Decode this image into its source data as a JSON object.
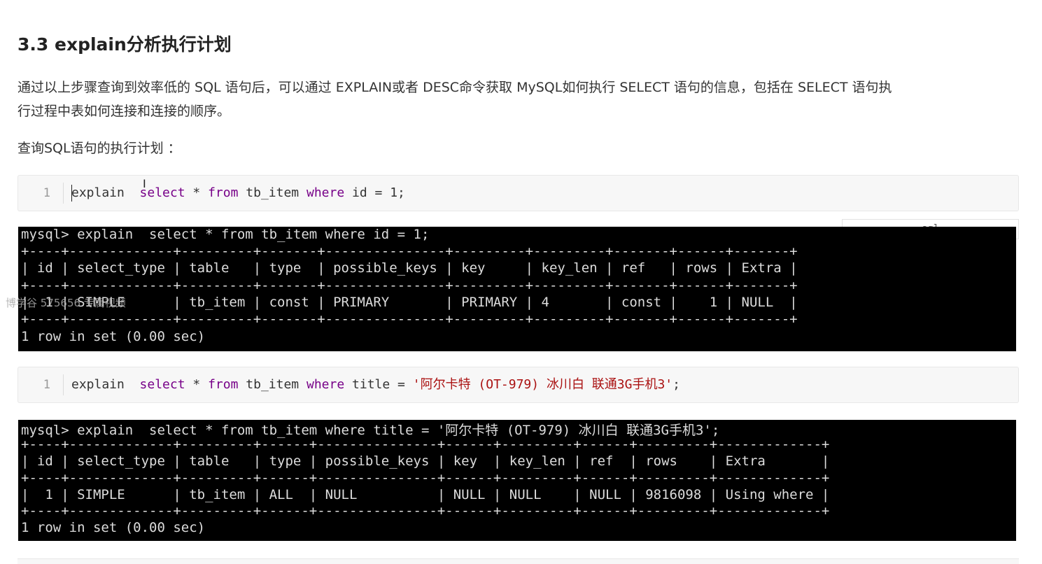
{
  "heading": "3.3 explain分析执行计划",
  "paragraph1_line1": "通过以上步骤查询到效率低的 SQL 语句后，可以通过 EXPLAIN或者 DESC命令获取 MySQL如何执行 SELECT 语句的信息，包括在 SELECT 语句执",
  "paragraph1_line2": "行过程中表如何连接和连接的顺序。",
  "paragraph2": "查询SQL语句的执行计划 ：",
  "code1": {
    "line_number": "1",
    "t_explain": "explain  ",
    "t_select": "select",
    "t_star": " * ",
    "t_from": "from",
    "t_table": " tb_item ",
    "t_where": "where",
    "t_rest": " id = 1;"
  },
  "code_language": "sql",
  "terminal1": {
    "lines": [
      "mysql> explain  select * from tb_item where id = 1;",
      "+----+-------------+---------+-------+---------------+---------+---------+-------+------+-------+",
      "| id | select_type | table   | type  | possible_keys | key     | key_len | ref   | rows | Extra |",
      "+----+-------------+---------+-------+---------------+---------+---------+-------+------+-------+",
      "|  1 | SIMPLE      | tb_item | const | PRIMARY       | PRIMARY | 4       | const |    1 | NULL  |",
      "+----+-------------+---------+-------+---------------+---------+---------+-------+------+-------+",
      "1 row in set (0.00 sec)"
    ]
  },
  "code2": {
    "line_number": "1",
    "t_explain": "explain  ",
    "t_select": "select",
    "t_star": " * ",
    "t_from": "from",
    "t_table": " tb_item ",
    "t_where": "where",
    "t_mid": " title = ",
    "t_string": "'阿尔卡特 (OT-979) 冰川白 联通3G手机3'",
    "t_end": ";"
  },
  "terminal2": {
    "lines": [
      "mysql> explain  select * from tb_item where title = '阿尔卡特 (OT-979) 冰川白 联通3G手机3';",
      "+----+-------------+---------+------+---------------+------+---------+------+---------+-------------+",
      "| id | select_type | table   | type | possible_keys | key  | key_len | ref  | rows    | Extra       |",
      "+----+-------------+---------+------+---------------+------+---------+------+---------+-------------+",
      "|  1 | SIMPLE      | tb_item | ALL  | NULL          | NULL | NULL    | NULL | 9816098 | Using where |",
      "+----+-------------+---------+------+---------------+------+---------+------+---------+-------------+",
      "1 row in set (0.00 sec)"
    ]
  },
  "watermark": "博学谷 575656 专属视频",
  "colors": {
    "keyword": "#770088",
    "string": "#aa1111",
    "terminal_bg": "#000000",
    "terminal_fg": "#dcdcdc",
    "code_bg": "#f7f7f7"
  }
}
